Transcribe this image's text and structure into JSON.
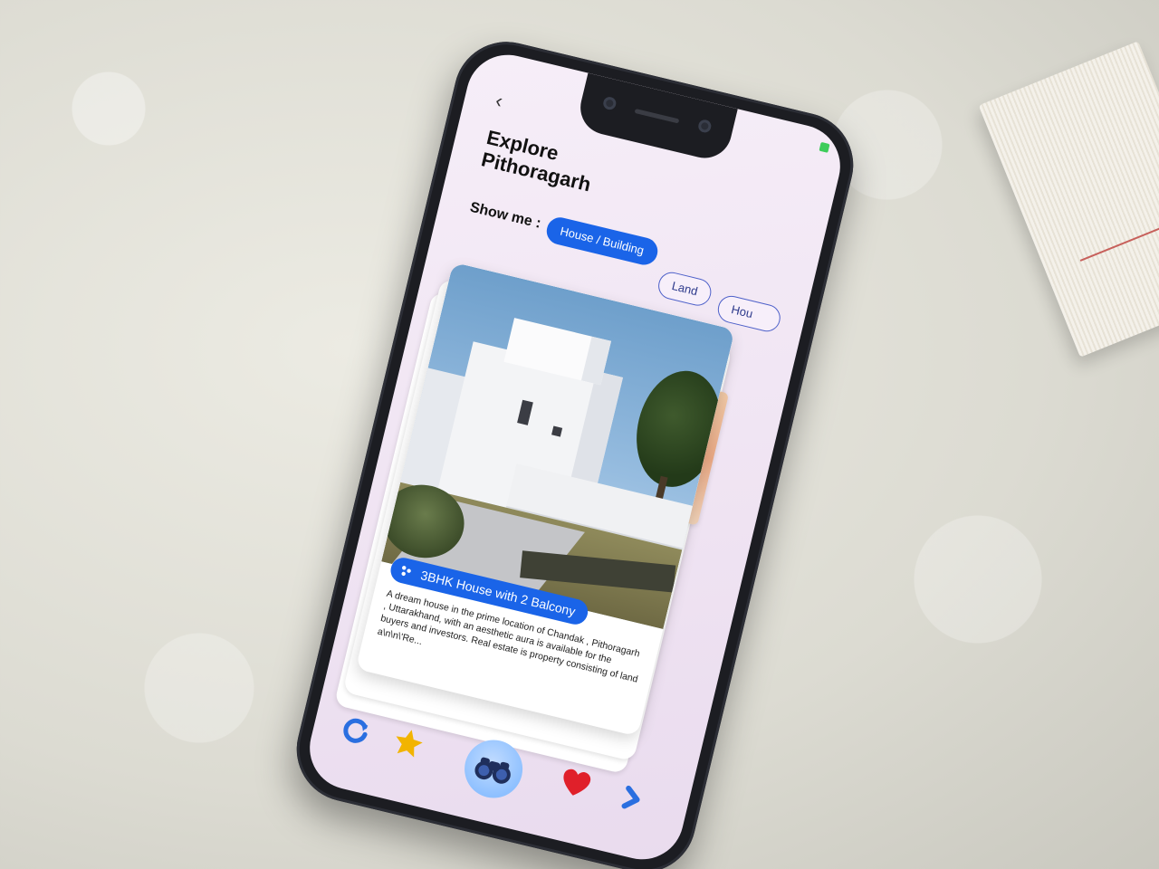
{
  "header": {
    "back_label": "‹",
    "title_line1": "Explore",
    "title_line2": "Pithoragarh"
  },
  "filters": {
    "label": "Show me :",
    "chips": [
      {
        "label": "House / Building",
        "active": true
      },
      {
        "label": "Land",
        "active": false
      },
      {
        "label": "Hou",
        "active": false
      }
    ]
  },
  "listing": {
    "title": "3BHK House with 2 Balcony",
    "description": "A dream house in the prime location of Chandak , Pithoragarh , Uttarakhand, with an aesthetic aura is available for the buyers and investors. Real estate is property consisting of land a\\n\\n\\'Re..."
  },
  "bottom_nav": {
    "refresh_icon": "refresh-icon",
    "star_icon": "star-icon",
    "explore_icon": "binoculars-icon",
    "heart_icon": "heart-icon",
    "next_icon": "chevron-right-icon"
  },
  "colors": {
    "accent": "#1a64e8",
    "screen_bg": "#f3e9f5",
    "heart": "#e0202a",
    "star": "#f2b400",
    "refresh": "#2a6fe0"
  }
}
